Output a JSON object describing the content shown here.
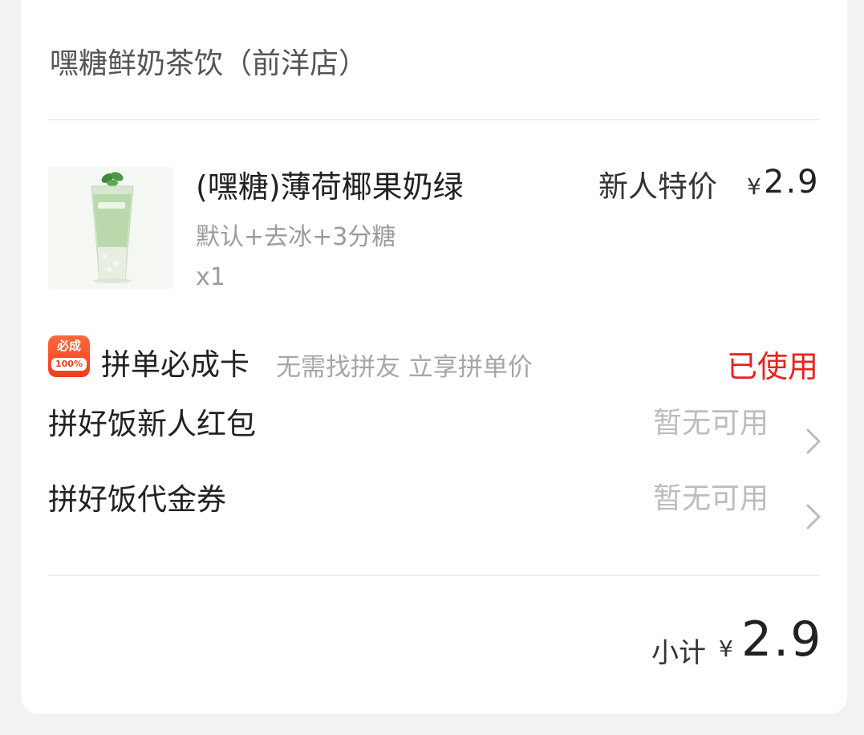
{
  "shop": {
    "name": "嘿糖鲜奶茶饮（前洋店）"
  },
  "product": {
    "name": "(嘿糖)薄荷椰果奶绿",
    "spec": "默认+去冰+3分糖",
    "quantity": "x1",
    "image_icon": "mint-milk-tea-cup-image",
    "promo_label": "新人特价",
    "price_symbol": "¥",
    "price": "2.9"
  },
  "group_card": {
    "badge_top": "必成",
    "badge_bottom": "100%",
    "title": "拼单必成卡",
    "description": "无需找拼友 立享拼单价",
    "status": "已使用",
    "status_color": "#e8231f",
    "badge_color": "#f23c1e"
  },
  "coupons": [
    {
      "label": "拼好饭新人红包",
      "value": "暂无可用",
      "icon": "chevron-right-icon"
    },
    {
      "label": "拼好饭代金券",
      "value": "暂无可用",
      "icon": "chevron-right-icon"
    }
  ],
  "subtotal": {
    "label": "小计",
    "symbol": "¥",
    "value": "2.9"
  }
}
